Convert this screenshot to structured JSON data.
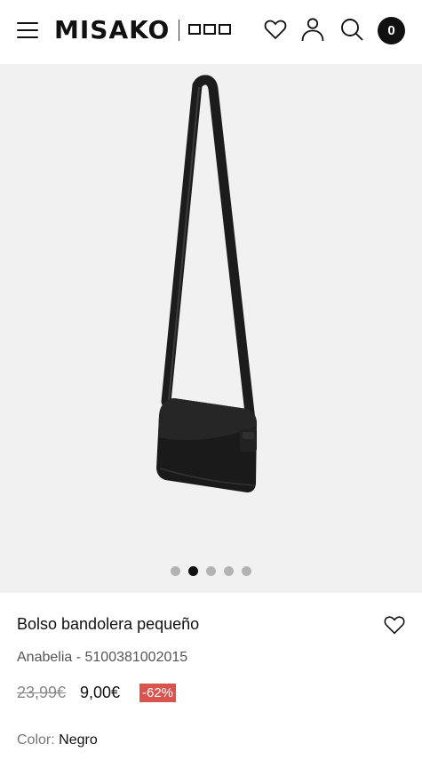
{
  "header": {
    "brand": "MISAKO",
    "cart_count": "0",
    "icons": [
      "menu-icon",
      "heart-icon",
      "user-icon",
      "search-icon"
    ]
  },
  "gallery": {
    "slide_count": 5,
    "active_slide": 2,
    "background": "#f1f1f1"
  },
  "product": {
    "name": "Bolso bandolera pequeño",
    "brand_ref": "Anabelia - 5100381002015",
    "price_old": "23,99€",
    "price_new": "9,00€",
    "discount": "-62%",
    "color_label": "Color:",
    "color_value": "Negro"
  },
  "colors": {
    "discount_badge": "#d9534f",
    "text": "#111111"
  }
}
